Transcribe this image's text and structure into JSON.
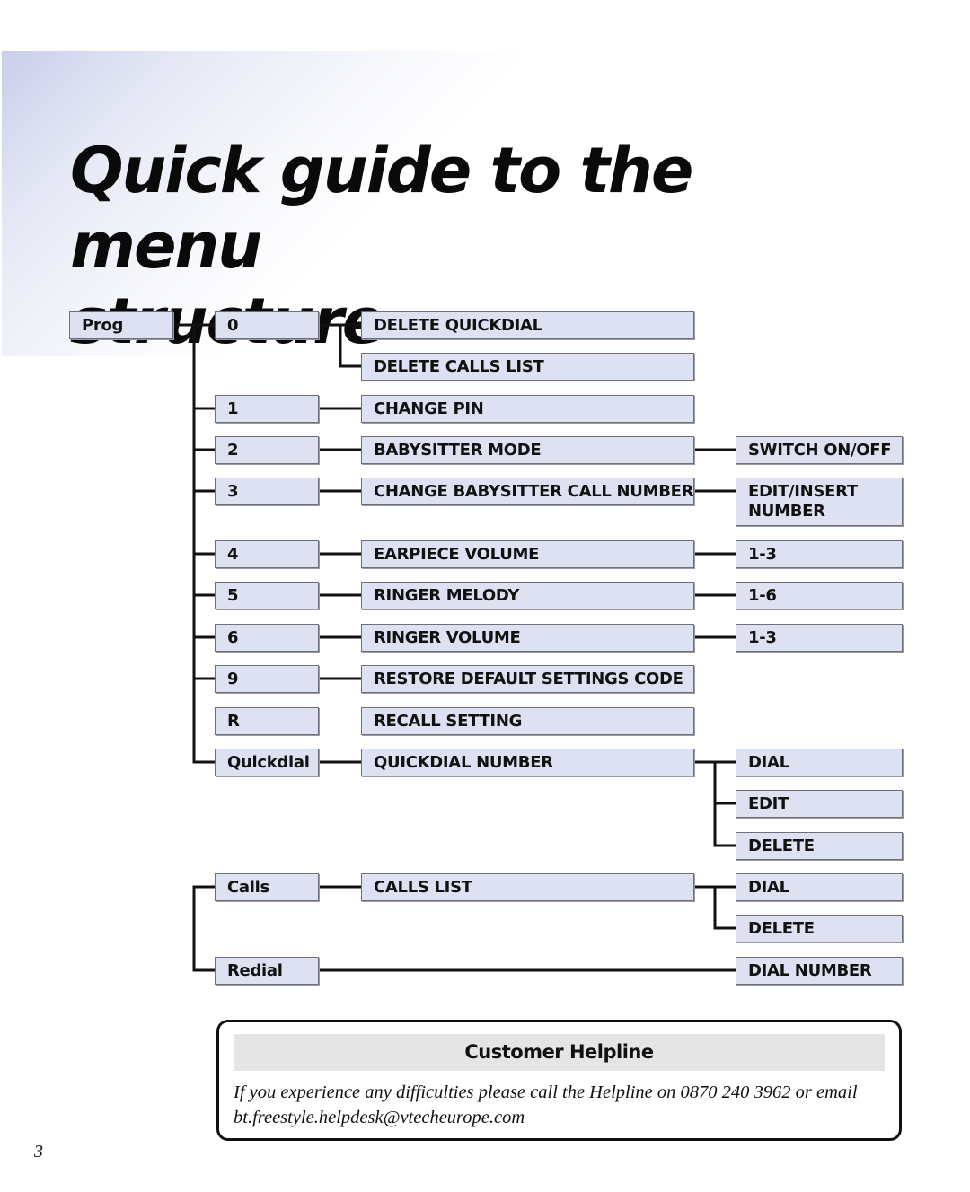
{
  "page": {
    "title": "Quick guide to the menu structure",
    "title_line1": "Quick guide to the menu",
    "title_line2": "structure",
    "page_number": "3"
  },
  "menu": {
    "root": "Prog",
    "level2": [
      "0",
      "1",
      "2",
      "3",
      "4",
      "5",
      "6",
      "9",
      "R",
      "Quickdial",
      "Calls",
      "Redial"
    ],
    "level3": [
      "DELETE QUICKDIAL",
      "DELETE CALLS LIST",
      "CHANGE PIN",
      "BABYSITTER MODE",
      "CHANGE BABYSITTER CALL NUMBER",
      "EARPIECE VOLUME",
      "RINGER MELODY",
      "RINGER VOLUME",
      "RESTORE DEFAULT SETTINGS CODE",
      "RECALL SETTING",
      "QUICKDIAL NUMBER",
      "CALLS LIST"
    ],
    "level4": [
      "SWITCH ON/OFF",
      "EDIT/INSERT NUMBER",
      "1-3",
      "1-6",
      "1-3",
      "DIAL",
      "EDIT",
      "DELETE",
      "DIAL",
      "DELETE",
      "DIAL NUMBER"
    ],
    "tree": [
      {
        "key": "0",
        "children": [
          {
            "label": "DELETE QUICKDIAL"
          },
          {
            "label": "DELETE CALLS LIST"
          }
        ]
      },
      {
        "key": "1",
        "children": [
          {
            "label": "CHANGE PIN"
          }
        ]
      },
      {
        "key": "2",
        "children": [
          {
            "label": "BABYSITTER MODE",
            "children": [
              "SWITCH ON/OFF"
            ]
          }
        ]
      },
      {
        "key": "3",
        "children": [
          {
            "label": "CHANGE BABYSITTER CALL NUMBER",
            "children": [
              "EDIT/INSERT NUMBER"
            ]
          }
        ]
      },
      {
        "key": "4",
        "children": [
          {
            "label": "EARPIECE VOLUME",
            "children": [
              "1-3"
            ]
          }
        ]
      },
      {
        "key": "5",
        "children": [
          {
            "label": "RINGER MELODY",
            "children": [
              "1-6"
            ]
          }
        ]
      },
      {
        "key": "6",
        "children": [
          {
            "label": "RINGER VOLUME",
            "children": [
              "1-3"
            ]
          }
        ]
      },
      {
        "key": "9",
        "children": [
          {
            "label": "RESTORE DEFAULT SETTINGS CODE"
          }
        ]
      },
      {
        "key": "R",
        "children": [
          {
            "label": "RECALL SETTING"
          }
        ]
      },
      {
        "key": "Quickdial",
        "children": [
          {
            "label": "QUICKDIAL NUMBER",
            "children": [
              "DIAL",
              "EDIT",
              "DELETE"
            ]
          }
        ]
      },
      {
        "key": "Calls",
        "children": [
          {
            "label": "CALLS LIST",
            "children": [
              "DIAL",
              "DELETE"
            ]
          }
        ]
      },
      {
        "key": "Redial",
        "children": [
          {
            "label": "DIAL NUMBER"
          }
        ]
      }
    ]
  },
  "helpline": {
    "heading": "Customer Helpline",
    "body": "If you experience any difficulties please call the Helpline on 0870 240 3962 or email bt.freestyle.helpdesk@vtecheurope.com",
    "phone": "0870 240 3962",
    "email": "bt.freestyle.helpdesk@vtecheurope.com"
  }
}
